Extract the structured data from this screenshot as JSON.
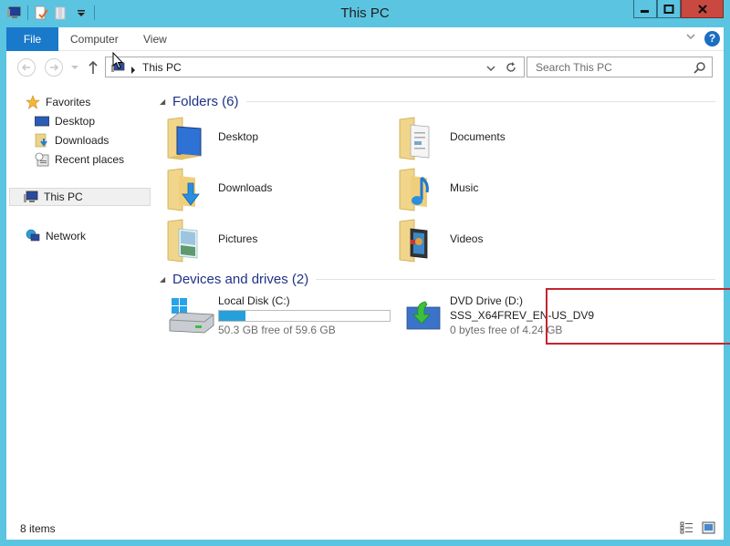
{
  "window": {
    "title": "This PC",
    "controls": {
      "minimize": "minimize",
      "maximize": "maximize",
      "close": "close"
    }
  },
  "ribbon": {
    "tabs": [
      {
        "label": "File",
        "active": true
      },
      {
        "label": "Computer",
        "active": false
      },
      {
        "label": "View",
        "active": false
      }
    ],
    "help_label": "?",
    "accent_color": "#1979ca"
  },
  "navigation": {
    "address": {
      "path": [
        "This PC"
      ]
    },
    "search": {
      "placeholder": "Search This PC"
    }
  },
  "sidebar": {
    "items": [
      {
        "label": "Favorites",
        "icon": "star-icon"
      },
      {
        "label": "Desktop",
        "icon": "desktop-icon"
      },
      {
        "label": "Downloads",
        "icon": "downloads-icon"
      },
      {
        "label": "Recent places",
        "icon": "recent-places-icon"
      },
      {
        "label": "This PC",
        "icon": "computer-icon",
        "selected": true
      },
      {
        "label": "Network",
        "icon": "network-icon"
      }
    ]
  },
  "main": {
    "groups": [
      {
        "label": "Folders (6)",
        "items": [
          {
            "name": "Desktop",
            "icon": "desktop-folder-icon"
          },
          {
            "name": "Documents",
            "icon": "documents-folder-icon"
          },
          {
            "name": "Downloads",
            "icon": "downloads-folder-icon"
          },
          {
            "name": "Music",
            "icon": "music-folder-icon"
          },
          {
            "name": "Pictures",
            "icon": "pictures-folder-icon"
          },
          {
            "name": "Videos",
            "icon": "videos-folder-icon"
          }
        ]
      },
      {
        "label": "Devices and drives (2)",
        "items": [
          {
            "name": "Local Disk (C:)",
            "free": "50.3 GB free of 59.6 GB",
            "used_fraction": 0.156,
            "icon": "hard-disk-icon"
          },
          {
            "name": "DVD Drive (D:)",
            "volume": "SSS_X64FREV_EN-US_DV9",
            "free": "0 bytes free of 4.24 GB",
            "icon": "dvd-drive-icon",
            "highlighted": true
          }
        ]
      }
    ]
  },
  "status": {
    "items_count": "8 items"
  },
  "colors": {
    "frame": "#5bc4e0",
    "highlight_border": "#c4262e",
    "usage_bar": "#26a0da",
    "close_button": "#c9483f"
  }
}
